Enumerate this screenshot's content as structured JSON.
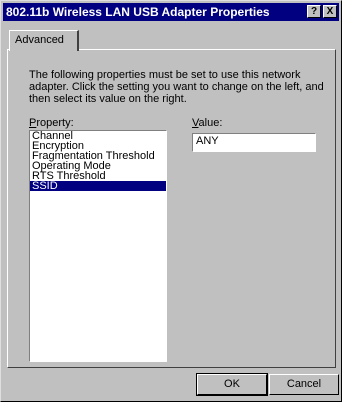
{
  "window": {
    "title": "802.11b Wireless LAN USB Adapter Properties",
    "help_label": "?",
    "close_label": "X"
  },
  "tabs": [
    {
      "label": "Advanced"
    }
  ],
  "description": "The following properties must be set to use this network adapter. Click the setting you want to change on the left, and then select its value on the right.",
  "property": {
    "label_accel": "P",
    "label_rest": "roperty:",
    "items": [
      {
        "label": "Channel"
      },
      {
        "label": "Encryption"
      },
      {
        "label": "Fragmentation Threshold"
      },
      {
        "label": "Operating Mode"
      },
      {
        "label": "RTS Threshold"
      },
      {
        "label": "SSID"
      }
    ],
    "selected": "SSID"
  },
  "value": {
    "label_accel": "V",
    "label_rest": "alue:",
    "current": "ANY"
  },
  "buttons": {
    "ok": "OK",
    "cancel": "Cancel"
  },
  "colors": {
    "face": "#c0c0c0",
    "titlebar": "#000080",
    "selection": "#000080"
  }
}
